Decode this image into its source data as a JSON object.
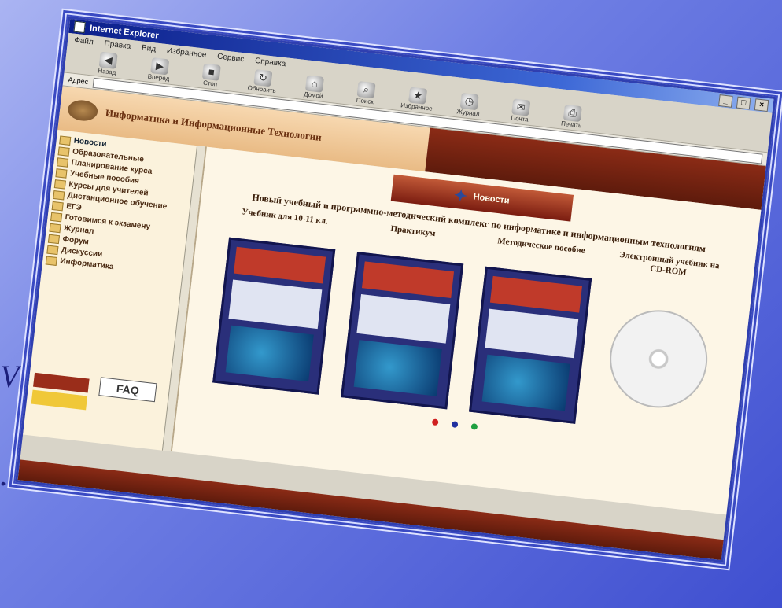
{
  "window": {
    "title": "Internet Explorer"
  },
  "menu": [
    "Файл",
    "Правка",
    "Вид",
    "Избранное",
    "Сервис",
    "Справка"
  ],
  "toolbar": [
    {
      "label": "Назад",
      "icon": "back-icon"
    },
    {
      "label": "Вперёд",
      "icon": "forward-icon"
    },
    {
      "label": "Стоп",
      "icon": "stop-icon"
    },
    {
      "label": "Обновить",
      "icon": "refresh-icon"
    },
    {
      "label": "Домой",
      "icon": "home-icon"
    },
    {
      "label": "Поиск",
      "icon": "search-icon"
    },
    {
      "label": "Избранное",
      "icon": "favorites-icon"
    },
    {
      "label": "Журнал",
      "icon": "history-icon"
    },
    {
      "label": "Почта",
      "icon": "mail-icon"
    },
    {
      "label": "Печать",
      "icon": "print-icon"
    }
  ],
  "address": {
    "label": "Адрес",
    "value": ""
  },
  "banner": {
    "title": "Информатика и Информационные Технологии",
    "right_text": ""
  },
  "sidebar": {
    "root": "Новости",
    "items": [
      "Образовательные",
      "Планирование курса",
      "Учебные пособия",
      "Курсы для учителей",
      "Дистанционное обучение",
      "ЕГЭ",
      "Готовимся к экзамену",
      "Журнал",
      "Форум",
      "Дискуссии",
      "Информатика"
    ],
    "faq": "FAQ"
  },
  "main": {
    "badge": "Новости",
    "headline": "Новый учебный и программно-методический комплекс по информатике и информационным технологиям",
    "cards": [
      {
        "label": "Учебник для 10-11 кл."
      },
      {
        "label": "Практикум"
      },
      {
        "label": "Методическое пособие"
      },
      {
        "label": "Электронный учебник на CD-ROM"
      }
    ],
    "legend": [
      {
        "label": "",
        "color": "#d02020"
      },
      {
        "label": "",
        "color": "#2030a0"
      },
      {
        "label": "",
        "color": "#20a040"
      }
    ]
  },
  "bottom": [
    "",
    ""
  ]
}
